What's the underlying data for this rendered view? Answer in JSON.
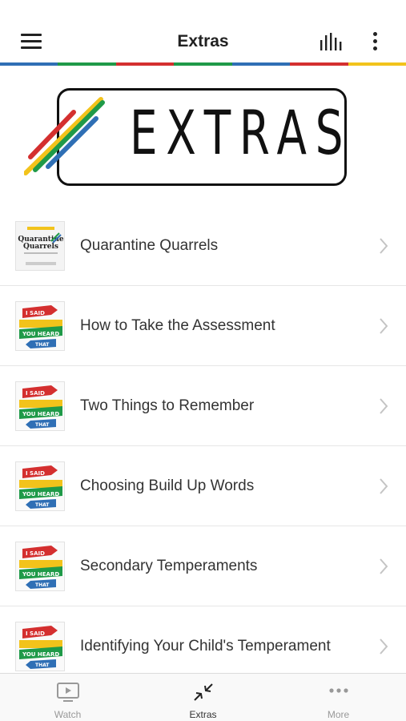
{
  "header": {
    "title": "Extras",
    "menu_icon": "hamburger-menu-icon",
    "audio_icon": "equalizer-icon",
    "more_icon": "vertical-ellipsis-icon"
  },
  "stripe_colors": [
    "#2f6fb5",
    "#1f9a48",
    "#d42f2f",
    "#1f9a48",
    "#2f6fb5",
    "#d42f2f",
    "#f2c31b"
  ],
  "banner": {
    "text": "EXTRAS"
  },
  "list": {
    "items": [
      {
        "label": "Quarantine Quarrels",
        "thumbnail": "quarantine-quarrels-book-cover"
      },
      {
        "label": "How to Take the Assessment",
        "thumbnail": "i-said-you-heard-that-logo"
      },
      {
        "label": "Two Things to Remember",
        "thumbnail": "i-said-you-heard-that-logo"
      },
      {
        "label": "Choosing Build Up Words",
        "thumbnail": "i-said-you-heard-that-logo"
      },
      {
        "label": "Secondary Temperaments",
        "thumbnail": "i-said-you-heard-that-logo"
      },
      {
        "label": "Identifying Your Child's Temperament",
        "thumbnail": "i-said-you-heard-that-logo"
      }
    ],
    "chevron_icon": "chevron-right-icon"
  },
  "book_cover": {
    "line1": "Quarantine",
    "line2": "Quarrels"
  },
  "logo_words": {
    "top": "I SAID",
    "middle": "YOU HEARD",
    "bottom": "THAT"
  },
  "tabs": [
    {
      "label": "Watch",
      "icon": "tv-play-icon",
      "active": false
    },
    {
      "label": "Extras",
      "icon": "collapse-arrows-icon",
      "active": true
    },
    {
      "label": "More",
      "icon": "horizontal-ellipsis-icon",
      "active": false
    }
  ]
}
